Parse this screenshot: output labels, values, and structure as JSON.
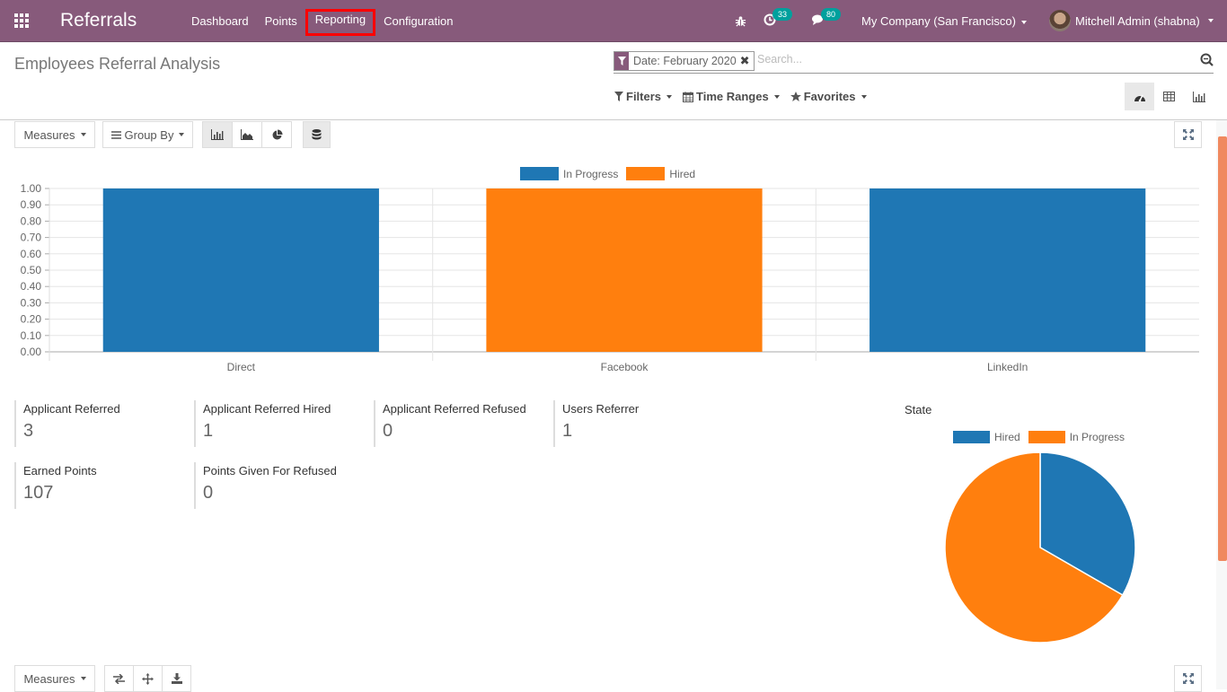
{
  "navbar": {
    "app_name": "Referrals",
    "menu": [
      {
        "label": "Dashboard"
      },
      {
        "label": "Points"
      },
      {
        "label": "Reporting",
        "highlighted": true
      },
      {
        "label": "Configuration"
      }
    ],
    "activity_count": "33",
    "messages_count": "80",
    "company": "My Company (San Francisco)",
    "user": "Mitchell Admin (shabna)",
    "accent_color": "#875a7b",
    "badge_color": "#00a09d"
  },
  "control_panel": {
    "title": "Employees Referral Analysis",
    "facet_label": "Date: February 2020",
    "search_placeholder": "Search...",
    "filters_label": "Filters",
    "time_ranges_label": "Time Ranges",
    "favorites_label": "Favorites",
    "views": [
      "dashboard-view",
      "pivot-view",
      "graph-view"
    ],
    "active_view": "dashboard-view"
  },
  "graph_toolbar": {
    "measures_label": "Measures",
    "group_by_label": "Group By",
    "chart_modes": [
      "bar",
      "line",
      "pie"
    ],
    "active_mode": "bar"
  },
  "pivot_toolbar": {
    "measures_label": "Measures"
  },
  "aggregates": [
    {
      "label": "Applicant Referred",
      "value": "3"
    },
    {
      "label": "Applicant Referred Hired",
      "value": "1"
    },
    {
      "label": "Applicant Referred Refused",
      "value": "0"
    },
    {
      "label": "Users Referrer",
      "value": "1"
    },
    {
      "label": "Earned Points",
      "value": "107"
    },
    {
      "label": "Points Given For Refused",
      "value": "0"
    }
  ],
  "state_title": "State",
  "chart_data": [
    {
      "type": "bar",
      "title": "",
      "xlabel": "",
      "ylabel": "",
      "categories": [
        "Direct",
        "Facebook",
        "LinkedIn"
      ],
      "series": [
        {
          "name": "In Progress",
          "color": "#1f77b4",
          "values": [
            1,
            0,
            1
          ]
        },
        {
          "name": "Hired",
          "color": "#ff7f0e",
          "values": [
            0,
            1,
            0
          ]
        }
      ],
      "ylim": [
        0,
        1
      ],
      "yticks": [
        "0.00",
        "0.10",
        "0.20",
        "0.30",
        "0.40",
        "0.50",
        "0.60",
        "0.70",
        "0.80",
        "0.90",
        "1.00"
      ],
      "grid": true,
      "legend": "top-center",
      "stacked": true
    },
    {
      "type": "pie",
      "title": "State",
      "slices": [
        {
          "label": "Hired",
          "value": 1,
          "color": "#1f77b4"
        },
        {
          "label": "In Progress",
          "value": 2,
          "color": "#ff7f0e"
        }
      ],
      "legend": "top-center"
    }
  ]
}
